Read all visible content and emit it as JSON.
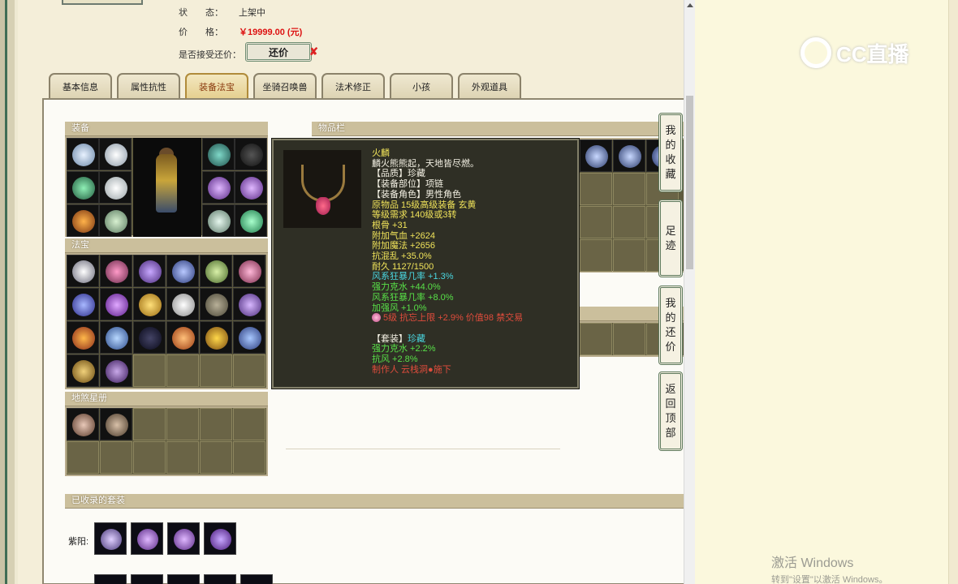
{
  "status": {
    "label": "状　　态：",
    "value": "上架中"
  },
  "price": {
    "label": "价　　格：",
    "value": "￥19999.00 (元)"
  },
  "bargain": {
    "label": "是否接受还价：",
    "button": "还价",
    "mark": "✘"
  },
  "tabs": [
    "基本信息",
    "属性抗性",
    "装备法宝",
    "坐骑召唤兽",
    "法术修正",
    "小孩",
    "外观道具"
  ],
  "active_tab": "装备法宝",
  "sections": {
    "equipment": "装备",
    "fabao": "法宝",
    "disha": "地煞星册",
    "inventory": "物品栏",
    "sets": "已收录的套装"
  },
  "tooltip": {
    "name": "火麟",
    "desc": "麟火熊熊起，天地皆尽燃。",
    "quality": "【品质】珍藏",
    "slot": "【装备部位】项链",
    "role": "【装备角色】男性角色",
    "origin": "原物品 15级高级装备 玄黄",
    "level_req": "等级需求 140级或3转",
    "gengu": "根骨 +31",
    "hp": "附加气血 +2624",
    "mp": "附加魔法 +2656",
    "resist_chaos": "抗混乱 +35.0%",
    "durability": "耐久 1127/1500",
    "wind_crit": "风系狂暴几率 +1.3%",
    "water_pierce": "强力克水 +44.0%",
    "wind_crit2": "风系狂暴几率 +8.0%",
    "strengthen_wind": "加强风 +1.0%",
    "gem_line": "5级 抗忘上限 +2.9% 价值98 禁交易",
    "set_title": "【套装】",
    "set_quality": "珍藏",
    "set_water": "强力克水 +2.2%",
    "set_wind": "抗风 +2.8%",
    "maker": "制作人 云栈洞●施下"
  },
  "float_menu": [
    [
      "我",
      "的",
      "收",
      "藏"
    ],
    [
      "足",
      "迹"
    ],
    [
      "我",
      "的",
      "还",
      "价"
    ],
    [
      "返",
      "回",
      "顶",
      "部"
    ]
  ],
  "sets_row": {
    "label": "紫阳:"
  },
  "overlay": {
    "logo": "CC直播",
    "activate_title": "激活 Windows",
    "activate_sub": "转到\"设置\"以激活 Windows。"
  },
  "colors": {
    "accent_red": "#d11111",
    "tab_active": "#8b3b10",
    "tooltip_bg": "#2f2f25"
  }
}
